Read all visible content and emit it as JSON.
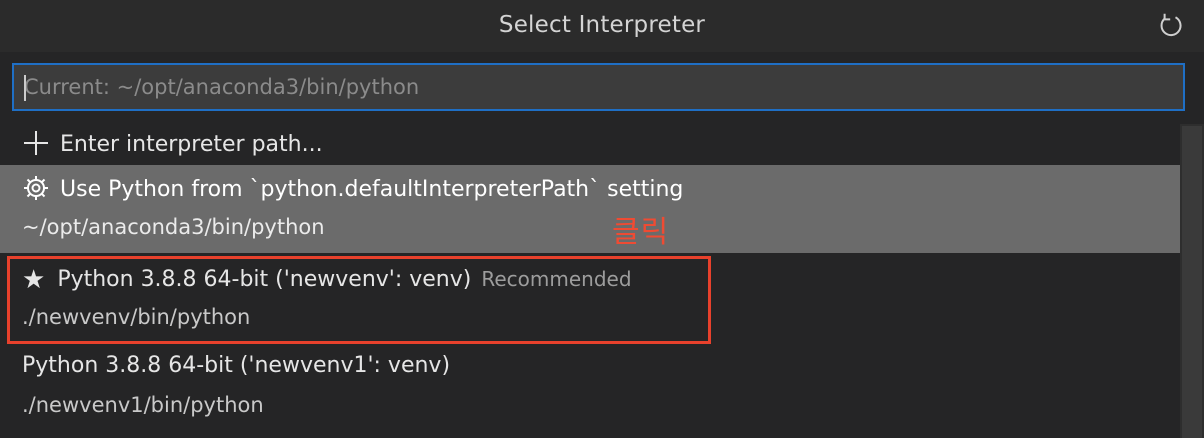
{
  "header": {
    "title": "Select Interpreter",
    "refresh_icon": "refresh-icon"
  },
  "search": {
    "placeholder": "Current: ~/opt/anaconda3/bin/python",
    "value": ""
  },
  "items": [
    {
      "icon": "plus-icon",
      "label": "Enter interpreter path..."
    },
    {
      "icon": "gear-icon",
      "label": "Use Python from `python.defaultInterpreterPath` setting",
      "detail": "~/opt/anaconda3/bin/python"
    },
    {
      "icon": "star-icon",
      "label": "Python 3.8.8 64-bit ('newvenv': venv)",
      "badge": "Recommended",
      "detail": "./newvenv/bin/python"
    },
    {
      "label": "Python 3.8.8 64-bit ('newvenv1': venv)",
      "detail": "./newvenv1/bin/python"
    }
  ],
  "annotation": {
    "text": "클릭",
    "color": "#e8412c"
  },
  "colors": {
    "background": "#252526",
    "focus_border": "#1f6fc5",
    "highlight_row": "#6b6b6b"
  }
}
